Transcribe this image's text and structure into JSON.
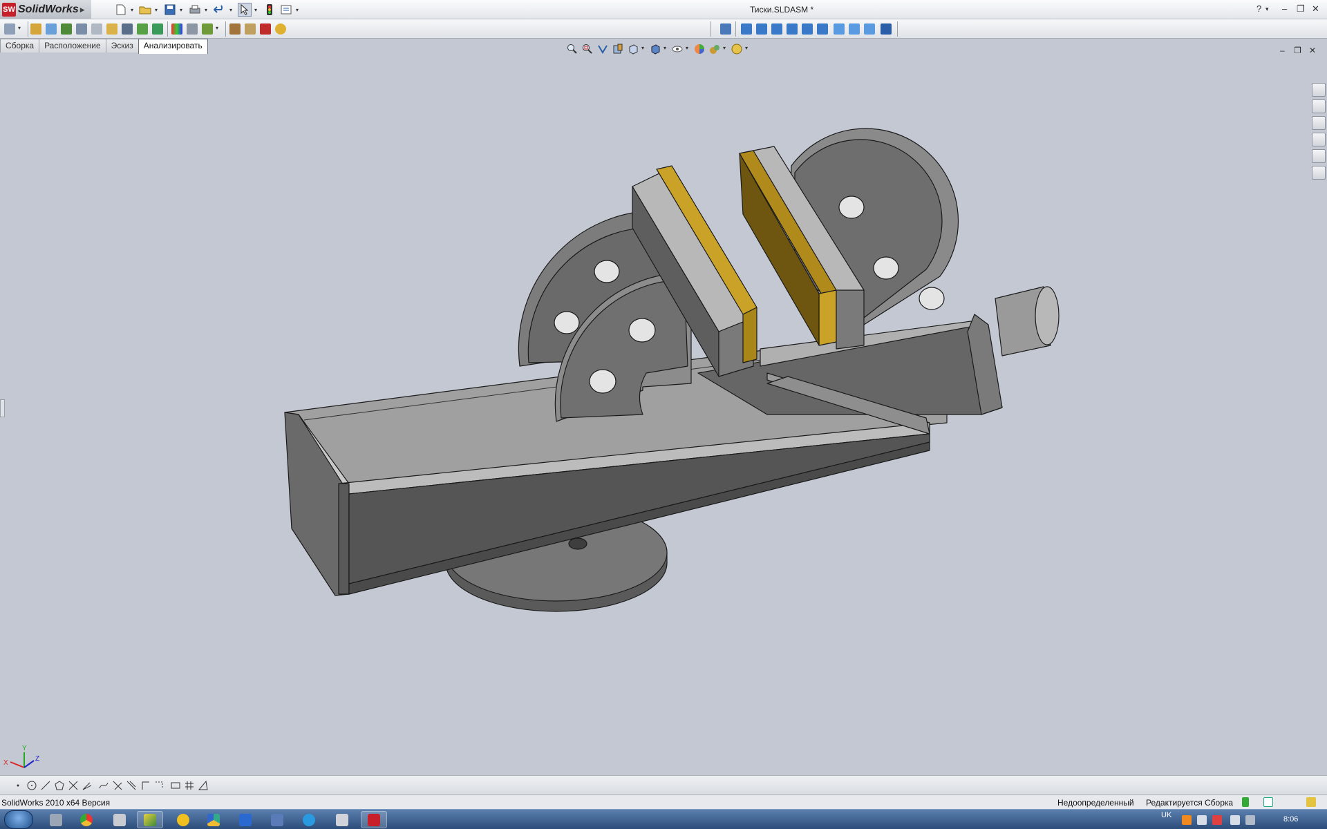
{
  "app": {
    "name": "SolidWorks",
    "document_title": "Тиски.SLDASM *"
  },
  "window_controls": {
    "help": "?",
    "help_arrow": "▾",
    "minimize": "–",
    "restore": "❐",
    "close": "✕"
  },
  "document_controls": {
    "minimize": "–",
    "restore": "❐",
    "close": "✕"
  },
  "tabs": [
    {
      "label": "Сборка",
      "active": false
    },
    {
      "label": "Расположение",
      "active": false
    },
    {
      "label": "Эскиз",
      "active": false
    },
    {
      "label": "Анализировать",
      "active": true
    }
  ],
  "status": {
    "version": "SolidWorks 2010 x64 Версия",
    "definition": "Недоопределенный",
    "mode": "Редактируется Сборка"
  },
  "triad": {
    "x": "X",
    "y": "Y",
    "z": "Z"
  },
  "taskbar": {
    "language": "UK",
    "clock": "8:06"
  },
  "colors": {
    "viewport": "#c3c8d2",
    "part_gray": "#8a8a8a",
    "jaw_gold": "#c9a227",
    "brand_red": "#c8202a"
  },
  "icons": {
    "menu": [
      "new-document-icon",
      "open-folder-icon",
      "save-icon",
      "print-icon",
      "undo-icon",
      "select-pointer-icon",
      "traffic-light-icon",
      "options-icon"
    ],
    "heads_up_view": [
      "zoom-to-fit-icon",
      "zoom-area-icon",
      "previous-view-icon",
      "section-view-icon",
      "view-orientation-icon",
      "display-style-icon",
      "hide-show-icon",
      "edit-appearance-icon",
      "apply-scene-icon",
      "view-settings-icon"
    ],
    "task_pane": [
      "solidworks-resources-icon",
      "design-library-icon",
      "file-explorer-icon",
      "view-palette-icon",
      "appearances-icon",
      "custom-properties-icon"
    ]
  }
}
